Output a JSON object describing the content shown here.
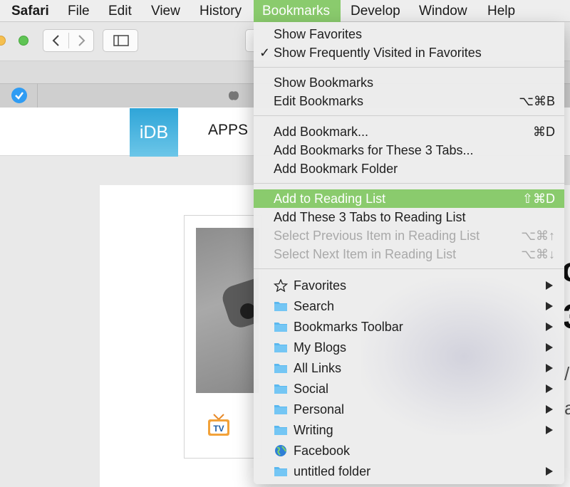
{
  "menubar": {
    "items": [
      "Safari",
      "File",
      "Edit",
      "View",
      "History",
      "Bookmarks",
      "Develop",
      "Window",
      "Help"
    ],
    "active": "Bookmarks"
  },
  "site": {
    "logo": "iDB",
    "nav_first": "APPS"
  },
  "menu": {
    "show_favorites": "Show Favorites",
    "check_mark": "✓",
    "show_frequently_visited": "Show Frequently Visited in Favorites",
    "show_bookmarks": "Show Bookmarks",
    "edit_bookmarks": "Edit Bookmarks",
    "edit_bookmarks_shortcut": "⌥⌘B",
    "add_bookmark": "Add Bookmark...",
    "add_bookmark_shortcut": "⌘D",
    "add_bookmarks_tabs": "Add Bookmarks for These 3 Tabs...",
    "add_bookmark_folder": "Add Bookmark Folder",
    "add_reading_list": "Add to Reading List",
    "add_reading_list_shortcut": "⇧⌘D",
    "add_tabs_reading_list": "Add These 3 Tabs to Reading List",
    "select_prev": "Select Previous Item in Reading List",
    "select_prev_shortcut": "⌥⌘↑",
    "select_next": "Select Next Item in Reading List",
    "select_next_shortcut": "⌥⌘↓",
    "bookmarks": [
      {
        "label": "Favorites",
        "icon": "star-icon",
        "submenu": true
      },
      {
        "label": "Search",
        "icon": "folder-icon",
        "submenu": true
      },
      {
        "label": "Bookmarks Toolbar",
        "icon": "folder-icon",
        "submenu": true
      },
      {
        "label": "My Blogs",
        "icon": "folder-icon",
        "submenu": true
      },
      {
        "label": "All Links",
        "icon": "folder-icon",
        "submenu": true
      },
      {
        "label": "Social",
        "icon": "folder-icon",
        "submenu": true
      },
      {
        "label": "Personal",
        "icon": "folder-icon",
        "submenu": true
      },
      {
        "label": "Writing",
        "icon": "folder-icon",
        "submenu": true
      },
      {
        "label": "Facebook",
        "icon": "globe-icon",
        "submenu": false
      },
      {
        "label": "untitled folder",
        "icon": "folder-icon",
        "submenu": true
      }
    ]
  },
  "colors": {
    "highlight": "#8acb6d",
    "folder": "#5ab8ef"
  }
}
